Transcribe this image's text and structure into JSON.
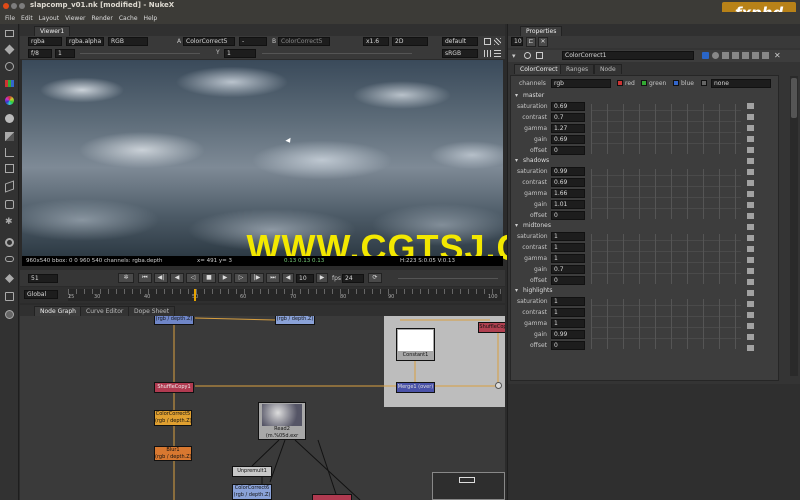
{
  "window": {
    "title": "slapcomp_v01.nk [modified] - NukeX"
  },
  "watermark": {
    "logo": "fxphd",
    "overlay_text": "WWW.CGTSJ.COM"
  },
  "menu": [
    "File",
    "Edit",
    "Layout",
    "Viewer",
    "Render",
    "Cache",
    "Help"
  ],
  "viewer": {
    "tab": "Viewer1",
    "layer": "rgba",
    "alpha": "rgba.alpha",
    "colorspace": "RGB",
    "input_a_label": "A",
    "input_a": "ColorCorrect5",
    "dash": "-",
    "input_b_label": "B",
    "input_b": "ColorCorrect5",
    "zoom": "x1.6",
    "view": "2D",
    "lut_default": "default",
    "lut_srgb": "sRGB",
    "fstop": "f/8",
    "fstop_val": "1",
    "y_label": "Y",
    "y_val": "1",
    "status_left": "960x540 bbox: 0 0 960 540 channels: rgba.depth",
    "status_mid": "x= 491 y= 3",
    "status_vals": "0.13  0.13  0.13",
    "status_right": "H:223 S:0.05 V:0.13"
  },
  "timeline": {
    "frame": "51",
    "fps_label": "fps",
    "fps": "24",
    "step": "10",
    "range_mode": "Global",
    "ticks": [
      "1",
      "25",
      "30",
      "40",
      "50",
      "60",
      "70",
      "80",
      "90",
      "100"
    ]
  },
  "lower_tabs": [
    "Node Graph",
    "Curve Editor",
    "Dope Sheet"
  ],
  "nodes": {
    "top_left": "(rgb / depth.Z)",
    "top_mid": "(rgb / depth.Z)",
    "top_right": "ShuffleCop",
    "shufflecopy": "ShuffleCopy1",
    "colorcorrect_top": "ColorCorrect5",
    "colorcorrect_top_sub": "(rgb / depth.Z)",
    "blur": "Blur1",
    "blur_sub": "(rgb / depth.Z)",
    "constant": "Constant1",
    "merge": "Merge1 (over)",
    "read_name": "Read2",
    "read_sub": "(m.%05d.exr",
    "unpremult": "Unpremult1",
    "colorcorrect_bottom": "ColorCorrect6",
    "colorcorrect_bottom_sub": "(rgb / depth.Z)",
    "colorcorrect_label": "ColorCorrect"
  },
  "properties": {
    "title": "Properties",
    "count": "10",
    "node_name": "ColorCorrect1",
    "tabs": [
      "ColorCorrect",
      "Ranges",
      "Node"
    ],
    "channels_label": "channels",
    "channels_value": "rgb",
    "chk_red": "red",
    "chk_green": "green",
    "chk_blue": "blue",
    "mask_value": "none",
    "scale_ticks": [
      "0",
      "0.5",
      "1",
      "1.5",
      "2",
      "2.5",
      "3",
      "3.5",
      "4"
    ],
    "sections": [
      {
        "name": "master",
        "rows": [
          {
            "label": "saturation",
            "value": "0.69"
          },
          {
            "label": "contrast",
            "value": "0.7"
          },
          {
            "label": "gamma",
            "value": "1.27"
          },
          {
            "label": "gain",
            "value": "0.69"
          },
          {
            "label": "offset",
            "value": "0"
          }
        ]
      },
      {
        "name": "shadows",
        "rows": [
          {
            "label": "saturation",
            "value": "0.99"
          },
          {
            "label": "contrast",
            "value": "0.69"
          },
          {
            "label": "gamma",
            "value": "1.66"
          },
          {
            "label": "gain",
            "value": "1.01"
          },
          {
            "label": "offset",
            "value": "0"
          }
        ]
      },
      {
        "name": "midtones",
        "rows": [
          {
            "label": "saturation",
            "value": "1"
          },
          {
            "label": "contrast",
            "value": "1"
          },
          {
            "label": "gamma",
            "value": "1"
          },
          {
            "label": "gain",
            "value": "0.7"
          },
          {
            "label": "offset",
            "value": "0"
          }
        ]
      },
      {
        "name": "highlights",
        "rows": [
          {
            "label": "saturation",
            "value": "1"
          },
          {
            "label": "contrast",
            "value": "1"
          },
          {
            "label": "gamma",
            "value": "1"
          },
          {
            "label": "gain",
            "value": "0.99"
          },
          {
            "label": "offset",
            "value": "0"
          }
        ]
      }
    ]
  }
}
